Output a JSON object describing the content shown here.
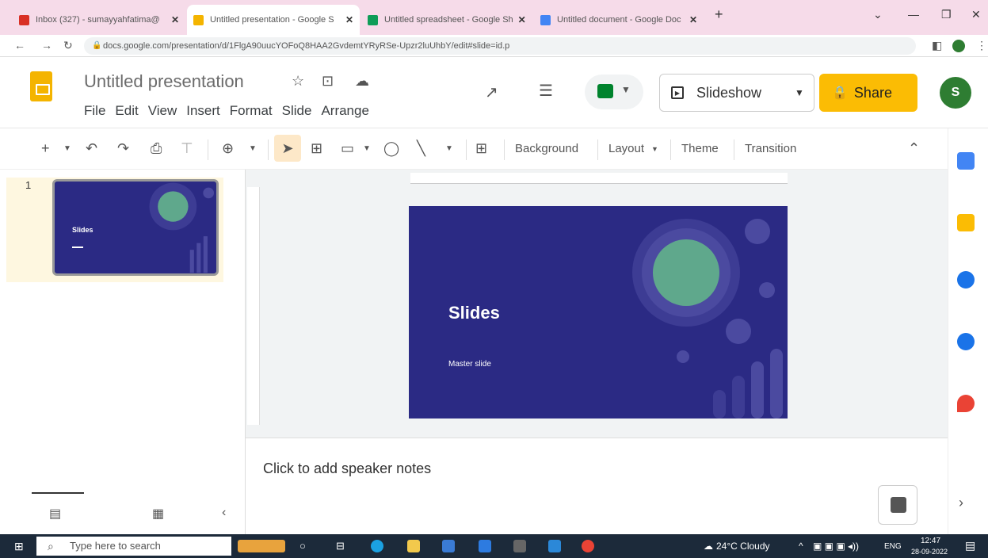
{
  "browser": {
    "tabs": [
      {
        "label": "Inbox (327) - sumayyahfatima@",
        "close": "✕",
        "color": "#d93025"
      },
      {
        "label": "Untitled presentation - Google S",
        "close": "✕",
        "color": "#f4b400"
      },
      {
        "label": "Untitled spreadsheet - Google Sh",
        "close": "✕",
        "color": "#0f9d58"
      },
      {
        "label": "Untitled document - Google Doc",
        "close": "✕",
        "color": "#4285f4"
      }
    ],
    "new_tab": "+",
    "url": "docs.google.com/presentation/d/1FlgA90uucYOFoQ8HAA2GvdemtYRyRSe-Upzr2luUhbY/edit#slide=id.p"
  },
  "app": {
    "title": "Untitled presentation",
    "menu": [
      "File",
      "Edit",
      "View",
      "Insert",
      "Format",
      "Slide",
      "Arrange"
    ],
    "slideshow_label": "Slideshow",
    "share_label": "Share",
    "avatar_letter": "S"
  },
  "toolbar": {
    "background": "Background",
    "layout": "Layout",
    "theme": "Theme",
    "transition": "Transition"
  },
  "slides": {
    "thumb_number": "1",
    "thumb_title": "Slides",
    "title": "Slides",
    "subtitle": "Master slide",
    "bg_color": "#2b2a84",
    "accent_color": "#5fa88c"
  },
  "notes": {
    "placeholder": "Click to add speaker notes"
  },
  "taskbar": {
    "search_placeholder": "Type here to search",
    "weather": "24°C  Cloudy",
    "language": "ENG",
    "time": "12:47",
    "date": "28-09-2022"
  }
}
